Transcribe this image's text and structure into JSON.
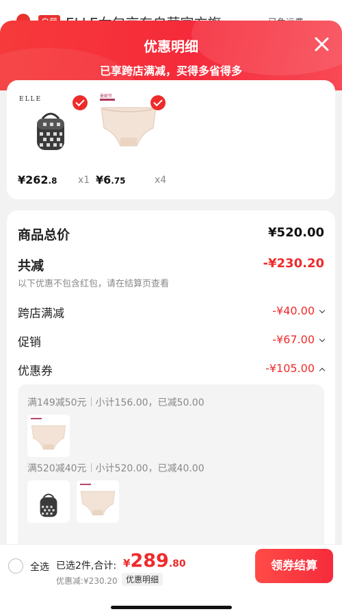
{
  "background": {
    "tag": "自营",
    "store_title": "ELLE女包京东自营官方旗",
    "shipping": "已免运费"
  },
  "modal": {
    "title": "优惠明细",
    "subtitle": "已享跨店满减，买得多省得多"
  },
  "products": [
    {
      "name": "ELLE backpack",
      "brand": "ELLE",
      "price_int": "¥262",
      "price_dec": ".8",
      "qty": "x1",
      "checked": true,
      "icon": "backpack-image"
    },
    {
      "name": "Underwear",
      "brand": "曼妮芬",
      "price_int": "¥6",
      "price_dec": ".75",
      "qty": "x4",
      "checked": true,
      "icon": "underwear-image"
    }
  ],
  "summary": {
    "total_label": "商品总价",
    "total_value": "¥520.00",
    "reduce_label": "共减",
    "reduce_value": "-¥230.20",
    "reduce_note": "以下优惠不包含红包，请在结算页查看",
    "items": [
      {
        "label": "跨店满减",
        "value": "-¥40.00",
        "expanded": false
      },
      {
        "label": "促销",
        "value": "-¥67.00",
        "expanded": false
      },
      {
        "label": "优惠券",
        "value": "-¥105.00",
        "expanded": true
      }
    ]
  },
  "coupons": [
    {
      "rule": "满149减50元",
      "subtotal": "小计156.00，已减50.00",
      "thumbs": [
        "underwear-image"
      ]
    },
    {
      "rule": "满520减40元",
      "subtotal": "小计520.00，已减40.00",
      "thumbs": [
        "backpack-image",
        "underwear-image"
      ]
    }
  ],
  "bottom": {
    "select_all": "全选",
    "selected_text": "已选2件,合计:",
    "total_currency": "¥",
    "total_int": "289",
    "total_dec": ".80",
    "discount_text": "优惠减:¥230.20",
    "detail_tag": "优惠明细",
    "checkout": "领券结算"
  },
  "colors": {
    "accent": "#ee2b2b",
    "hero_start": "#f63a3a",
    "hero_end": "#f84a56"
  }
}
